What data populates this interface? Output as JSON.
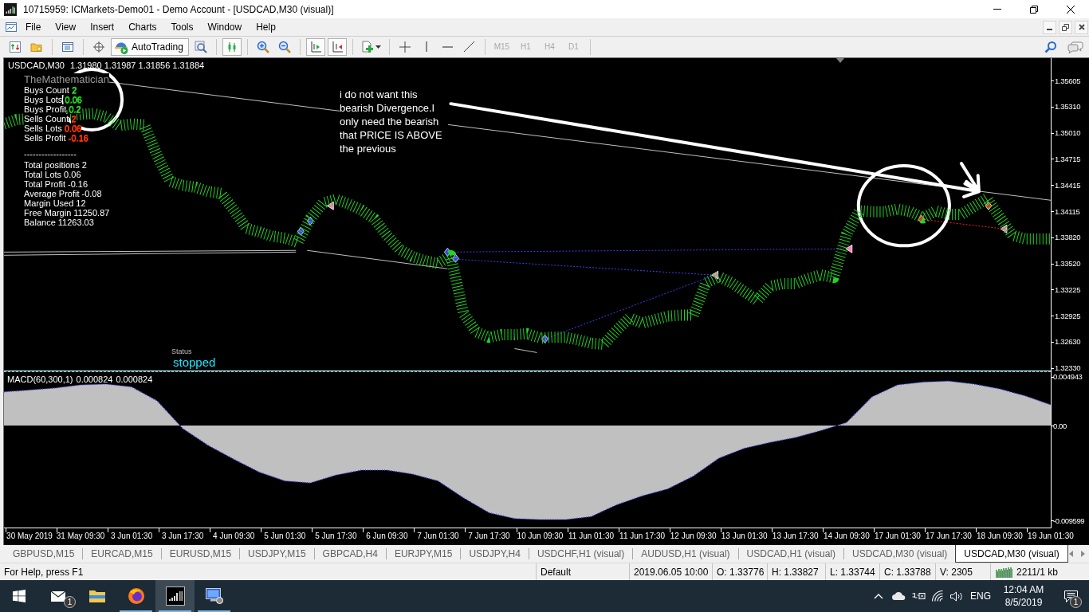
{
  "window": {
    "title": "10715959: ICMarkets-Demo01 - Demo Account - [USDCAD,M30 (visual)]"
  },
  "menu": [
    "File",
    "View",
    "Insert",
    "Charts",
    "Tools",
    "Window",
    "Help"
  ],
  "toolbar": {
    "autotrading": {
      "label": "AutoTrading",
      "on": true
    },
    "bar_chart": {
      "pressed": true
    },
    "chart_shift": {
      "pressed": true
    },
    "auto_scroll": {
      "pressed": true
    },
    "timeframes": [
      {
        "label": "M15",
        "disabled": true
      },
      {
        "label": "H1",
        "disabled": true
      },
      {
        "label": "H4",
        "disabled": true
      },
      {
        "label": "D1",
        "disabled": true
      }
    ]
  },
  "chart": {
    "header": {
      "ohlc": "1.31980 1.31987 1.31856 1.31884"
    },
    "expert": {
      "title": "TheMathematician",
      "positions": [
        {
          "label": "Buys Count",
          "value": "2",
          "color": "#22dd22"
        },
        {
          "label": "Buys Lots",
          "value": "0.06",
          "color": "#22dd22"
        },
        {
          "label": "Buys Profit",
          "value": "0.2",
          "color": "#22dd22"
        },
        {
          "label": "Sells Count",
          "value": "2",
          "color": "#ff3300"
        },
        {
          "label": "Sells Lots",
          "value": "0.06",
          "color": "#ff3300"
        },
        {
          "label": "Sells Profit",
          "value": "-0.16",
          "color": "#ff3300"
        }
      ],
      "divider": "------------------",
      "totals": [
        {
          "label": "Total positions",
          "value": "2"
        },
        {
          "label": "Total Lots",
          "value": "0.06"
        },
        {
          "label": "Total Profit",
          "value": "-0.16"
        },
        {
          "label": "Average Profit",
          "value": "-0.08"
        },
        {
          "label": "Margin Used",
          "value": "12"
        },
        {
          "label": "Free Margin",
          "value": "11250.87"
        },
        {
          "label": "Balance",
          "value": "11263.03"
        }
      ]
    },
    "note": "i do not want this bearish Divergence.I only need the bearish that PRICE IS ABOVE the previous",
    "status": {
      "label": "Status",
      "value": "stopped"
    },
    "price": {
      "chart_data": {
        "type": "line",
        "categories": [
          null,
          null,
          null,
          null,
          null,
          null,
          null,
          null,
          null,
          null,
          null,
          null,
          null,
          null,
          null,
          null,
          null,
          null,
          null,
          null,
          null,
          null,
          null,
          null,
          null,
          null,
          null,
          null,
          null,
          null,
          null,
          null,
          null,
          null,
          null,
          null,
          null,
          null,
          null,
          null,
          null,
          null,
          null,
          null,
          null,
          null,
          null,
          null,
          null,
          null,
          null,
          null,
          null,
          null,
          null,
          null,
          null,
          null,
          null,
          null,
          null,
          null,
          null,
          null,
          null,
          null,
          null,
          null,
          null,
          null,
          null,
          null,
          null,
          null,
          null,
          null,
          null,
          null,
          null,
          null,
          null,
          null,
          null
        ],
        "series": [
          {
            "name": "USDCAD,M30",
            "color": "#22d422",
            "line_style": "dashed",
            "values": [
              1.3511,
              1.3516,
              null,
              null,
              null,
              null,
              null,
              1.3523,
              1.3519,
              1.3509,
              1.3511,
              1.351,
              1.3475,
              1.3446,
              1.3441,
              1.3439,
              1.3434,
              1.3432,
              1.3413,
              1.3392,
              1.3388,
              1.3383,
              1.3381,
              1.3376,
              1.3403,
              1.3421,
              1.3425,
              1.342,
              1.3413,
              1.3403,
              1.3384,
              1.3368,
              1.336,
              1.3355,
              1.3352,
              1.3361,
              1.3295,
              1.3274,
              1.3268,
              1.3271,
              1.3271,
              1.3272,
              1.3267,
              1.3268,
              1.3268,
              1.3265,
              1.3261,
              1.326,
              1.3276,
              1.329,
              1.3284,
              1.3288,
              1.3292,
              1.3293,
              1.3293,
              1.333,
              1.3337,
              1.333,
              1.332,
              1.331,
              1.3326,
              1.3329,
              1.3329,
              1.3335,
              1.3339,
              1.3336,
              1.3385,
              1.3412,
              1.3411,
              1.3411,
              1.3414,
              1.3411,
              1.3404,
              1.3412,
              1.3408,
              1.3408,
              1.3417,
              1.3426,
              1.3405,
              1.3384,
              1.338,
              1.338,
              1.338
            ]
          }
        ],
        "ylim": [
          1.323,
          1.3586
        ],
        "yticks": [
          {
            "value": 1.35605,
            "label": "1.35605"
          },
          {
            "value": 1.3531,
            "label": "1.35310"
          },
          {
            "value": 1.3501,
            "label": "1.35010"
          },
          {
            "value": 1.34715,
            "label": "1.34715"
          },
          {
            "value": 1.34415,
            "label": "1.34415"
          },
          {
            "value": 1.34115,
            "label": "1.34115"
          },
          {
            "value": 1.3382,
            "label": "1.33820"
          },
          {
            "value": 1.3352,
            "label": "1.33520"
          },
          {
            "value": 1.33225,
            "label": "1.33225"
          },
          {
            "value": 1.32925,
            "label": "1.32925"
          },
          {
            "value": 1.3263,
            "label": "1.32630"
          },
          {
            "value": 1.3233,
            "label": "1.32330"
          }
        ]
      }
    },
    "indicator": {
      "values": [
        "0.000824",
        "0.000824"
      ],
      "chart_data": {
        "type": "area",
        "title": "MACD(60,300,1)",
        "categories": [
          null,
          "30 May 2019",
          null,
          "31 May 09:30",
          null,
          "3 Jun 01:30",
          null,
          "3 Jun 17:30",
          null,
          "4 Jun 09:30",
          null,
          "5 Jun 01:30",
          null,
          "5 Jun 17:30",
          null,
          "6 Jun 09:30",
          null,
          "7 Jun 01:30",
          null,
          "7 Jun 17:30",
          null,
          "10 Jun 09:30",
          null,
          "11 Jun 01:30",
          null,
          "11 Jun 17:30",
          null,
          "12 Jun 09:30",
          null,
          "13 Jun 01:30",
          null,
          "13 Jun 17:30",
          null,
          "14 Jun 09:30",
          null,
          "17 Jun 01:30",
          null,
          "17 Jun 17:30",
          null,
          "18 Jun 09:30",
          null,
          "19 Jun 01:30"
        ],
        "series": [
          {
            "color": "#c0c0c0",
            "values": [
              0.0034,
              0.0036,
              0.0038,
              0.0041,
              0.0042,
              0.0039,
              0.0025,
              -0.0003,
              -0.002,
              -0.0034,
              -0.0047,
              -0.0056,
              -0.0058,
              -0.005,
              -0.0045,
              -0.0045,
              -0.0049,
              -0.0056,
              -0.0073,
              -0.0088,
              -0.0094,
              -0.0095,
              -0.0095,
              -0.0092,
              -0.008,
              -0.0071,
              -0.0064,
              -0.0051,
              -0.0033,
              -0.0023,
              -0.0017,
              -0.0012,
              -0.0005,
              0.0003,
              0.0029,
              0.0041,
              0.0044,
              0.0045,
              0.0042,
              0.0037,
              0.003,
              0.0021
            ]
          }
        ],
        "ylim": [
          -0.0103,
          0.0054
        ],
        "yticks": [
          {
            "value": 0.004943,
            "label": "0.004943"
          },
          {
            "value": 0,
            "label": "0.00"
          },
          {
            "value": -0.009599,
            "label": "-0.009599"
          }
        ]
      }
    }
  },
  "tabs": [
    {
      "label": "GBPUSD,M15",
      "selected": false
    },
    {
      "label": "EURCAD,M15",
      "selected": false
    },
    {
      "label": "EURUSD,M15",
      "selected": false
    },
    {
      "label": "USDJPY,M15",
      "selected": false
    },
    {
      "label": "GBPCAD,H4",
      "selected": false
    },
    {
      "label": "EURJPY,M15",
      "selected": false
    },
    {
      "label": "USDJPY,H4",
      "selected": false
    },
    {
      "label": "USDCHF,H1 (visual)",
      "selected": false
    },
    {
      "label": "AUDUSD,H1 (visual)",
      "selected": false
    },
    {
      "label": "USDCAD,H1 (visual)",
      "selected": false
    },
    {
      "label": "USDCAD,M30 (visual)",
      "selected": false
    },
    {
      "label": "USDCAD,M30 (visual)",
      "selected": true
    }
  ],
  "status_bar": {
    "help": "For Help, press F1",
    "profile": "Default",
    "time": "2019.06.05 10:00",
    "open": "O: 1.33776",
    "high": "H: 1.33827",
    "low": "L: 1.33744",
    "close": "C: 1.33788",
    "volume": "V: 2305",
    "traffic": "2211/1 kb"
  },
  "taskbar": {
    "apps": [
      {
        "badge": "1",
        "running": false,
        "active": false
      },
      {
        "running": false,
        "active": false
      },
      {
        "running": true,
        "active": false
      },
      {
        "running": true,
        "active": true
      },
      {
        "running": true,
        "active": false
      }
    ],
    "language": "ENG",
    "time": "12:04 AM",
    "date": "8/5/2019",
    "notifications": "1"
  }
}
